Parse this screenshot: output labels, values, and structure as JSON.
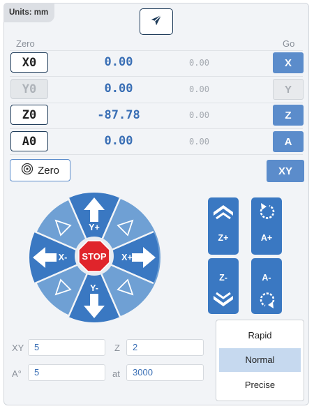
{
  "units_badge": "Units: mm",
  "header": {
    "zero_label": "Zero",
    "go_label": "Go",
    "send_icon": "paper-plane-icon"
  },
  "axes": [
    {
      "axis": "X",
      "zero_label": "X0",
      "work_pos": "0.00",
      "machine_pos": "0.00",
      "go_label": "X",
      "enabled": true
    },
    {
      "axis": "Y",
      "zero_label": "Y0",
      "work_pos": "0.00",
      "machine_pos": "0.00",
      "go_label": "Y",
      "enabled": false
    },
    {
      "axis": "Z",
      "zero_label": "Z0",
      "work_pos": "-87.78",
      "machine_pos": "0.00",
      "go_label": "Z",
      "enabled": true
    },
    {
      "axis": "A",
      "zero_label": "A0",
      "work_pos": "0.00",
      "machine_pos": "0.00",
      "go_label": "A",
      "enabled": true
    }
  ],
  "zero_button": {
    "label": "Zero",
    "icon": "target-icon"
  },
  "go_xy_label": "XY",
  "jog": {
    "stop_label": "STOP",
    "y_plus": "Y+",
    "y_minus": "Y-",
    "x_plus": "X+",
    "x_minus": "X-",
    "z_plus": "Z+",
    "z_minus": "Z-",
    "a_plus": "A+",
    "a_minus": "A-"
  },
  "speed": {
    "options": [
      "Rapid",
      "Normal",
      "Precise"
    ],
    "selected": "Normal"
  },
  "fields": {
    "xy_label": "XY",
    "xy_value": "5",
    "z_label": "Z",
    "z_value": "2",
    "a_label": "A°",
    "a_value": "5",
    "at_label": "at",
    "at_value": "3000"
  },
  "colors": {
    "accent": "#5b8ccb",
    "jog_primary": "#3a78c2",
    "jog_secondary": "#6fa0d4",
    "stop": "#e0242b"
  }
}
